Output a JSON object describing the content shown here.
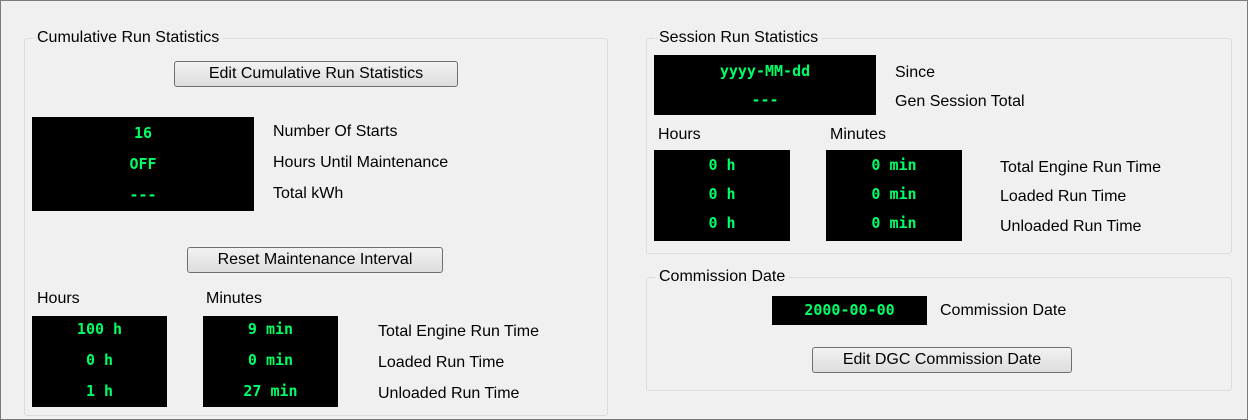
{
  "cumulative": {
    "title": "Cumulative Run Statistics",
    "edit_button": "Edit Cumulative Run Statistics",
    "stats": [
      {
        "value": "16",
        "label": "Number Of Starts"
      },
      {
        "value": "OFF",
        "label": "Hours Until Maintenance"
      },
      {
        "value": "---",
        "label": "Total kWh"
      }
    ],
    "reset_button": "Reset Maintenance Interval",
    "hours_header": "Hours",
    "minutes_header": "Minutes",
    "hours": [
      "100 h",
      "0 h",
      "1 h"
    ],
    "minutes": [
      "9 min",
      "0 min",
      "27 min"
    ],
    "run_labels": [
      "Total Engine Run Time",
      "Loaded Run Time",
      "Unloaded Run Time"
    ]
  },
  "session": {
    "title": "Session Run Statistics",
    "since_value": "yyyy-MM-dd",
    "since_label": "Since",
    "total_value": "---",
    "total_label": "Gen Session Total",
    "hours_header": "Hours",
    "minutes_header": "Minutes",
    "hours": [
      "0 h",
      "0 h",
      "0 h"
    ],
    "minutes": [
      "0 min",
      "0 min",
      "0 min"
    ],
    "run_labels": [
      "Total Engine Run Time",
      "Loaded Run Time",
      "Unloaded Run Time"
    ]
  },
  "commission": {
    "title": "Commission Date",
    "date_value": "2000-00-00",
    "date_label": "Commission Date",
    "edit_button": "Edit DGC Commission Date"
  }
}
